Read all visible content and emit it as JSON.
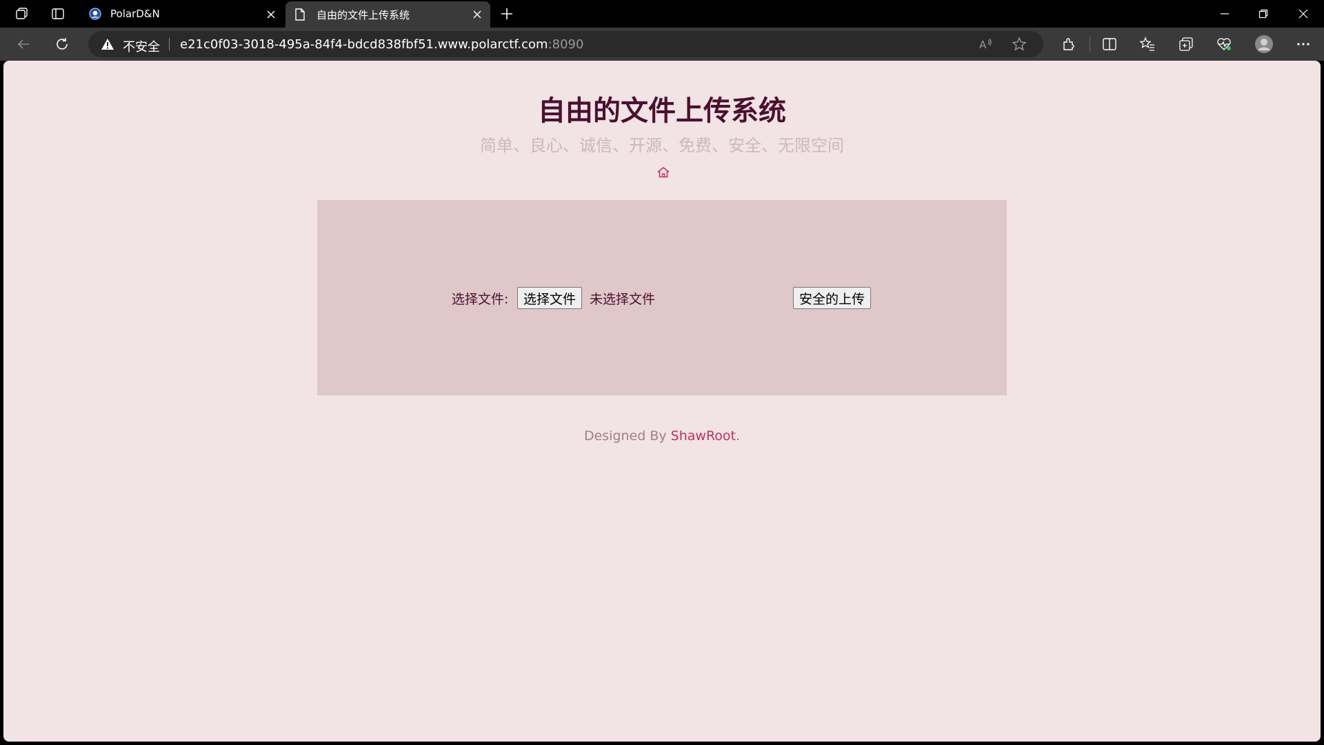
{
  "browser": {
    "tabs": [
      {
        "title": "PolarD&N",
        "active": false
      },
      {
        "title": "自由的文件上传系统",
        "active": true
      }
    ],
    "address": {
      "security_label": "不安全",
      "host": "e21c0f03-3018-495a-84f4-bdcd838fbf51.www.polarctf.com",
      "port": ":8090"
    },
    "colors": {
      "chrome_bg": "#000000",
      "toolbar_bg": "#3a3a3a",
      "omnibox_bg": "#2a2a2a",
      "active_tab_bg": "#3a3a3a"
    }
  },
  "page": {
    "title": "自由的文件上传系统",
    "subtitle": "简单、良心、诚信、开源、免费、安全、无限空间",
    "home_icon": "home-icon",
    "form": {
      "file_label": "选择文件:",
      "file_button_label": "选择文件",
      "file_status": "未选择文件",
      "submit_label": "安全的上传"
    },
    "footer": {
      "prefix": "Designed By ",
      "author": "ShawRoot",
      "suffix": "."
    },
    "colors": {
      "background": "#f2e3e4",
      "panel": "#dfc7ca",
      "title": "#4a1030",
      "subtitle": "#cdb8bd",
      "accent": "#c0325a"
    }
  }
}
